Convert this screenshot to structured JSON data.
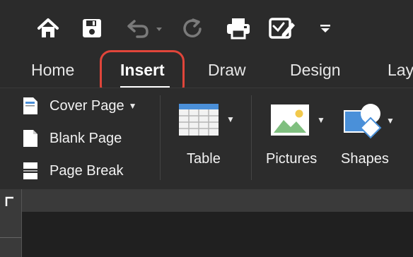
{
  "quick_access": {
    "icons": [
      "home-icon",
      "save-icon",
      "undo-icon",
      "redo-icon",
      "print-icon",
      "edit-document-icon",
      "customize-toolbar-icon"
    ]
  },
  "tabs": [
    {
      "label": "Home"
    },
    {
      "label": "Insert",
      "active": true
    },
    {
      "label": "Draw"
    },
    {
      "label": "Design"
    },
    {
      "label": "Lay"
    }
  ],
  "ribbon": {
    "pages": {
      "cover_page": "Cover Page",
      "blank_page": "Blank Page",
      "page_break": "Page Break"
    },
    "table_label": "Table",
    "pictures_label": "Pictures",
    "shapes_label": "Shapes"
  },
  "colors": {
    "background": "#2b2b2b",
    "highlight": "#e0453a",
    "table_header": "#4a8fd8",
    "shape_fill": "#4a90d9"
  }
}
